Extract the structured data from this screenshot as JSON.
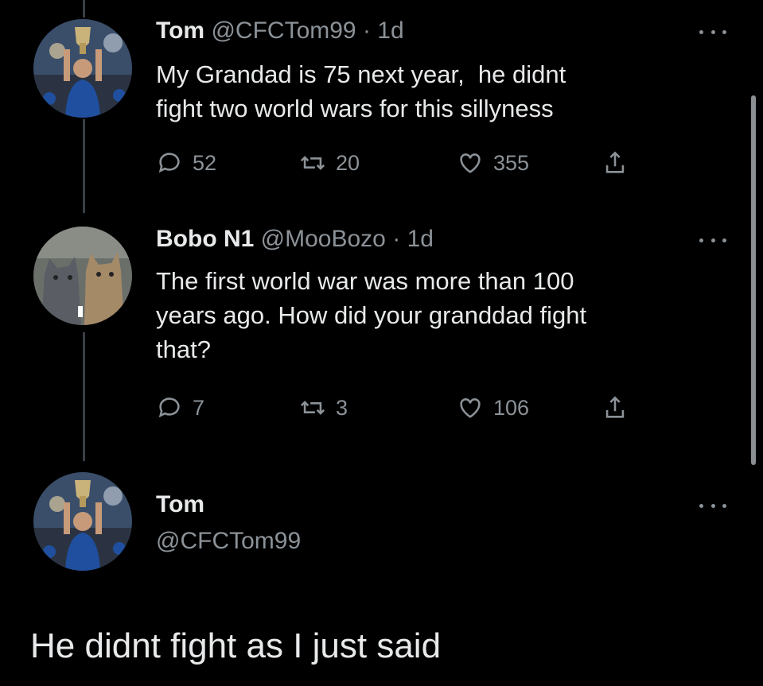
{
  "tweets": [
    {
      "name": "Tom",
      "handle": "@CFCTom99",
      "dot": "·",
      "time": "1d",
      "text": "My Grandad is 75 next year,  he didnt\nfight two world wars for this sillyness",
      "replies": "52",
      "retweets": "20",
      "likes": "355",
      "avatar": "footballer-with-trophy"
    },
    {
      "name": "Bobo N1",
      "handle": "@MooBozo",
      "dot": "·",
      "time": "1d",
      "text": "The first world war was more than 100\nyears ago. How did your granddad fight\nthat?",
      "replies": "7",
      "retweets": "3",
      "likes": "106",
      "avatar": "two-cats"
    }
  ],
  "focused_tweet": {
    "name": "Tom",
    "handle": "@CFCTom99",
    "text": "He didnt fight as I just said",
    "avatar": "footballer-with-trophy"
  },
  "colors": {
    "background": "#000000",
    "text": "#e7e9ea",
    "muted": "#8b9298",
    "thread_line": "#3a3f44"
  },
  "icons": [
    "reply-icon",
    "retweet-icon",
    "like-icon",
    "share-icon",
    "more-icon"
  ]
}
